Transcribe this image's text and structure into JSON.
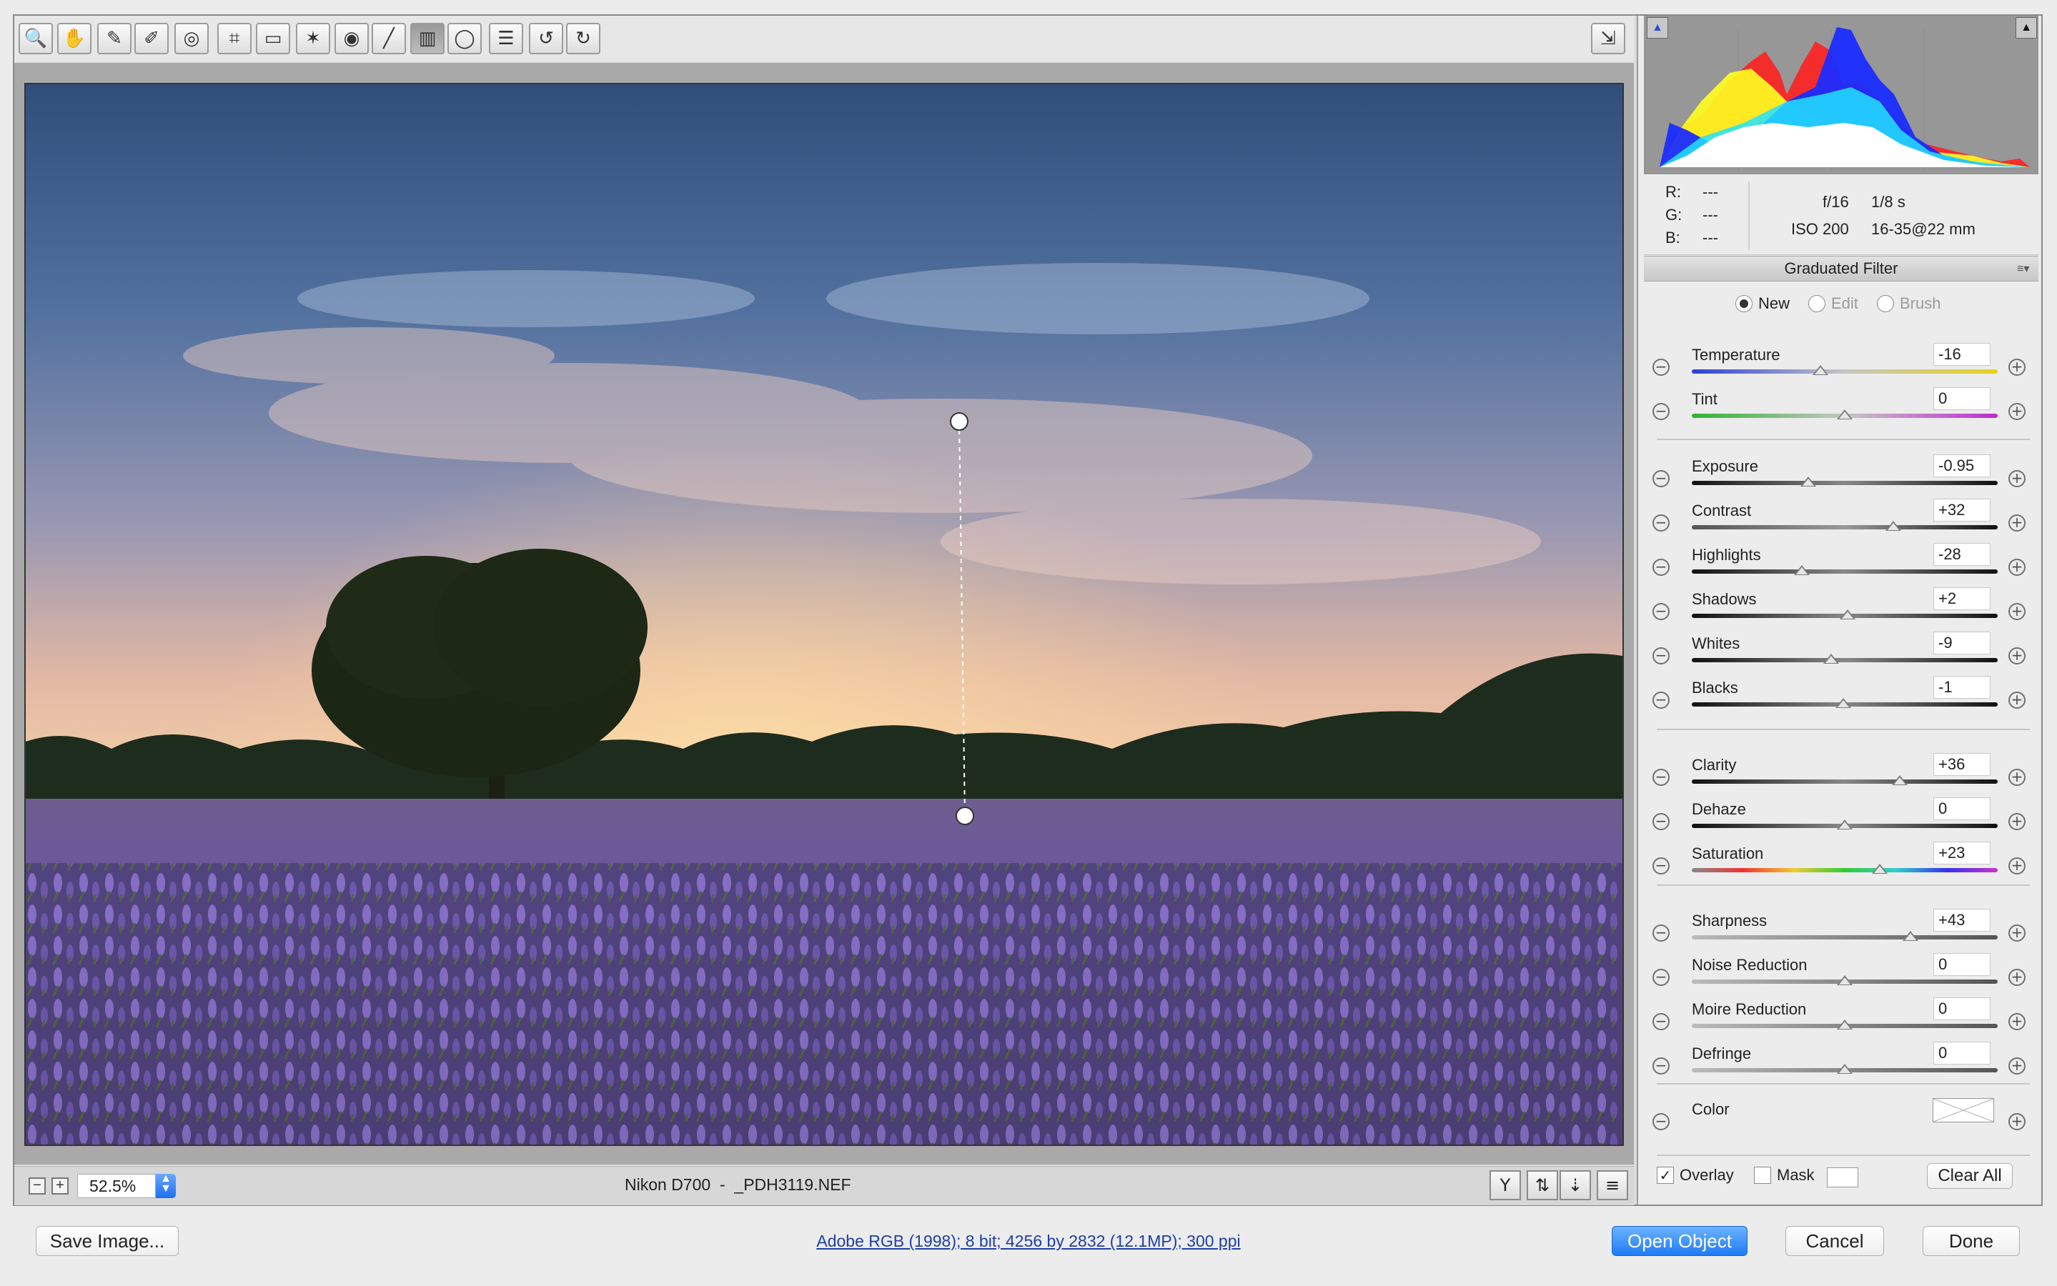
{
  "toolbar": {
    "tools": [
      {
        "name": "zoom-tool",
        "icon": "magnifier-icon",
        "glyph": "🔍"
      },
      {
        "name": "hand-tool",
        "icon": "hand-icon",
        "glyph": "✋"
      },
      {
        "name": "white-balance-tool",
        "icon": "eyedropper-icon",
        "glyph": "✎"
      },
      {
        "name": "color-sampler-tool",
        "icon": "color-sampler-icon",
        "glyph": "✐"
      },
      {
        "name": "targeted-adjustment-tool",
        "icon": "target-icon",
        "glyph": "◎"
      },
      {
        "name": "crop-tool",
        "icon": "crop-icon",
        "glyph": "⌗"
      },
      {
        "name": "straighten-tool",
        "icon": "straighten-icon",
        "glyph": "▭"
      },
      {
        "name": "spot-removal-tool",
        "icon": "spot-removal-icon",
        "glyph": "✶"
      },
      {
        "name": "red-eye-tool",
        "icon": "red-eye-icon",
        "glyph": "◉"
      },
      {
        "name": "adjustment-brush-tool",
        "icon": "brush-icon",
        "glyph": "╱"
      },
      {
        "name": "graduated-filter-tool",
        "icon": "graduated-filter-icon",
        "glyph": "▥"
      },
      {
        "name": "radial-filter-tool",
        "icon": "radial-filter-icon",
        "glyph": "◯"
      },
      {
        "name": "preferences-tool",
        "icon": "list-icon",
        "glyph": "☰"
      },
      {
        "name": "rotate-left-tool",
        "icon": "rotate-left-icon",
        "glyph": "↺"
      },
      {
        "name": "rotate-right-tool",
        "icon": "rotate-right-icon",
        "glyph": "↻"
      }
    ],
    "fullscreen_icon": "⇲"
  },
  "status": {
    "zoom": "52.5%",
    "file": "Nikon D700  -  _PDH3119.NEF"
  },
  "readout": {
    "r_label": "R:",
    "g_label": "G:",
    "b_label": "B:",
    "r_val": "---",
    "g_val": "---",
    "b_val": "---",
    "aperture": "f/16",
    "shutter": "1/8 s",
    "iso": "ISO 200",
    "lens": "16-35@22 mm"
  },
  "panel": {
    "title": "Graduated Filter",
    "mode_new": "New",
    "mode_edit": "Edit",
    "mode_brush": "Brush"
  },
  "sliders": [
    {
      "label": "Temperature",
      "value": "-16",
      "pos": 0.42,
      "track": "linear-gradient(90deg,#2d3fd6,#c6c6c6,#e6d21a)"
    },
    {
      "label": "Tint",
      "value": "0",
      "pos": 0.5,
      "track": "linear-gradient(90deg,#2fb52f,#c6c6c6,#c12bd1)"
    },
    {
      "label": "Exposure",
      "value": "-0.95",
      "pos": 0.38,
      "track": "linear-gradient(90deg,#111,#888,#111)"
    },
    {
      "label": "Contrast",
      "value": "+32",
      "pos": 0.66,
      "track": "linear-gradient(90deg,#555,#999,#111)"
    },
    {
      "label": "Highlights",
      "value": "-28",
      "pos": 0.36,
      "track": "linear-gradient(90deg,#111,#888,#111)"
    },
    {
      "label": "Shadows",
      "value": "+2",
      "pos": 0.51,
      "track": "linear-gradient(90deg,#111,#888,#111)"
    },
    {
      "label": "Whites",
      "value": "-9",
      "pos": 0.455,
      "track": "linear-gradient(90deg,#111,#888,#111)"
    },
    {
      "label": "Blacks",
      "value": "-1",
      "pos": 0.495,
      "track": "linear-gradient(90deg,#111,#888,#111)"
    },
    {
      "label": "Clarity",
      "value": "+36",
      "pos": 0.68,
      "track": "linear-gradient(90deg,#111,#888,#111)"
    },
    {
      "label": "Dehaze",
      "value": "0",
      "pos": 0.5,
      "track": "linear-gradient(90deg,#111,#888,#111)"
    },
    {
      "label": "Saturation",
      "value": "+23",
      "pos": 0.615,
      "track": "linear-gradient(90deg,#888,#e33,#ec3,#3c3,#3cc,#33e,#c3c)"
    },
    {
      "label": "Sharpness",
      "value": "+43",
      "pos": 0.715,
      "track": "linear-gradient(90deg,#bbb,#555)"
    },
    {
      "label": "Noise Reduction",
      "value": "0",
      "pos": 0.5,
      "track": "linear-gradient(90deg,#bbb,#555)"
    },
    {
      "label": "Moire Reduction",
      "value": "0",
      "pos": 0.5,
      "track": "linear-gradient(90deg,#bbb,#555)"
    },
    {
      "label": "Defringe",
      "value": "0",
      "pos": 0.5,
      "track": "linear-gradient(90deg,#bbb,#555)"
    }
  ],
  "color_label": "Color",
  "overlay_label": "Overlay",
  "mask_label": "Mask",
  "clear_all": "Clear All",
  "footer": {
    "save": "Save Image...",
    "info": "Adobe RGB (1998); 8 bit; 4256 by 2832 (12.1MP); 300 ppi",
    "open": "Open Object",
    "cancel": "Cancel",
    "done": "Done"
  },
  "colors": {
    "accent": "#1f7bf4",
    "link": "#1d3ea6"
  }
}
